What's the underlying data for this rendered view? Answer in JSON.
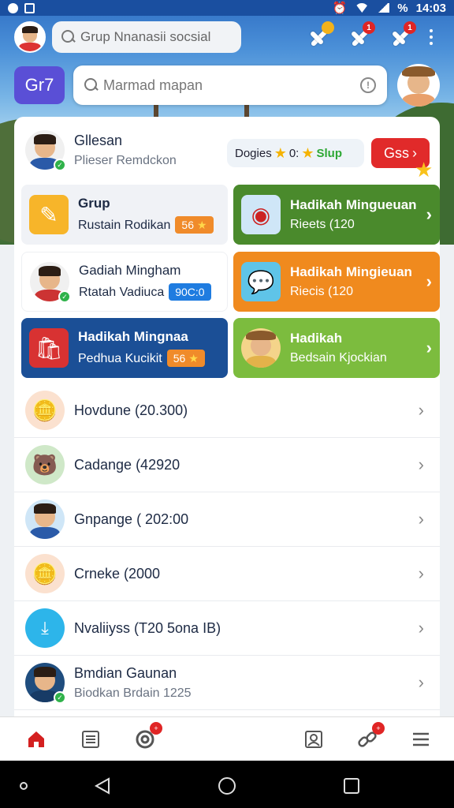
{
  "status_bar": {
    "time": "14:03",
    "battery": "% "
  },
  "top_search": {
    "placeholder": "Grup Nnanasii socsial"
  },
  "top_badges": [
    "",
    "1",
    "1"
  ],
  "group_button": {
    "label": "Gr7"
  },
  "map_search": {
    "placeholder": "Marmad mapan"
  },
  "profile": {
    "name": "Gllesan",
    "subtitle": "Plieser Remdckon",
    "dogies_label": "Dogies",
    "dogies_value": "0:",
    "slup_label": "Slup",
    "gss_button": "Gss"
  },
  "tiles": [
    {
      "title": "Grup",
      "subtitle": "Rustain Rodikan",
      "pill": "56",
      "style": "light"
    },
    {
      "title": "Hadikah Mingueuan",
      "subtitle": "Rieets (120",
      "style": "green"
    },
    {
      "title": "Gadiah Mingham",
      "subtitle": "Rtatah Vadiuca",
      "pill": "90C:0",
      "style": "white"
    },
    {
      "title": "Hadikah Mingieuan",
      "subtitle": "Riecis (120",
      "style": "orange"
    },
    {
      "title": "Hadikah Mingnaa",
      "subtitle": "Pedhua Kucikit",
      "pill": "56",
      "style": "navy"
    },
    {
      "title": "Hadikah",
      "subtitle": "Bedsain Kjockian",
      "style": "lime"
    }
  ],
  "list": [
    {
      "title": "Hovdune (20.300)",
      "subtitle": ""
    },
    {
      "title": "Cadange (42920",
      "subtitle": ""
    },
    {
      "title": "Gnpange ( 202:00",
      "subtitle": ""
    },
    {
      "title": "Crneke (2000",
      "subtitle": ""
    },
    {
      "title": "Nvaliiyss (T20 5ona IB)",
      "subtitle": ""
    },
    {
      "title": "Bmdian Gaunan",
      "subtitle": "Biodkan Brdain 1225"
    }
  ],
  "colors": {
    "accent_purple": "#5a4fd6",
    "red": "#e12a2a",
    "green": "#4a8a2c",
    "orange": "#f08a1e",
    "navy": "#1b4f96",
    "lime": "#7cbc3e"
  },
  "icons": {
    "nav": [
      "home-icon",
      "list-icon",
      "target-icon",
      "contact-icon",
      "link-icon",
      "menu-icon"
    ]
  }
}
